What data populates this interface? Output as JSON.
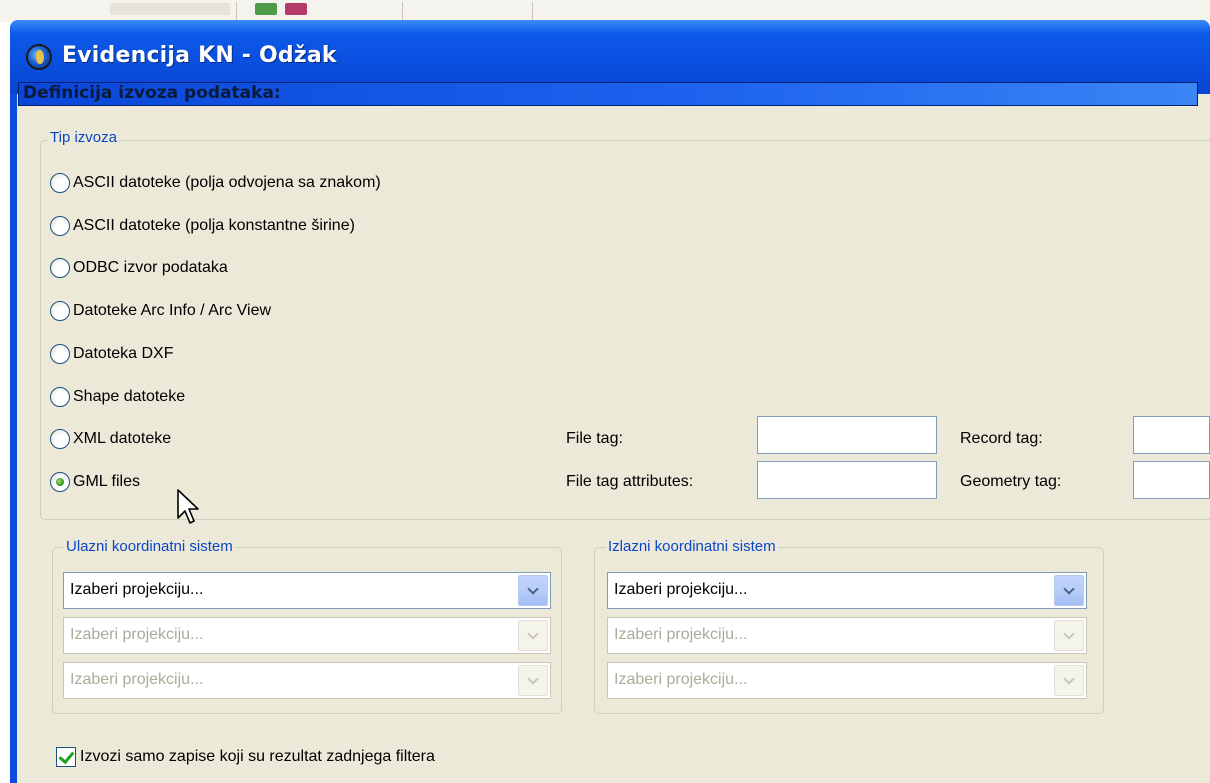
{
  "window": {
    "title": "Evidencija KN - Odžak"
  },
  "section_title": "Definicija izvoza podataka:",
  "export_type": {
    "legend": "Tip izvoza",
    "options": [
      {
        "label": "ASCII datoteke (polja odvojena sa znakom)",
        "checked": false
      },
      {
        "label": "ASCII datoteke (polja konstantne širine)",
        "checked": false
      },
      {
        "label": "ODBC izvor podataka",
        "checked": false
      },
      {
        "label": "Datoteke Arc Info / Arc View",
        "checked": false
      },
      {
        "label": "Datoteka DXF",
        "checked": false
      },
      {
        "label": "Shape datoteke",
        "checked": false
      },
      {
        "label": "XML datoteke",
        "checked": false
      },
      {
        "label": "GML files",
        "checked": true
      }
    ],
    "fields": {
      "file_tag_label": "File tag:",
      "file_tag_value": "",
      "record_tag_label": "Record tag:",
      "record_tag_value": "",
      "file_tag_attributes_label": "File tag attributes:",
      "file_tag_attributes_value": "",
      "geometry_tag_label": "Geometry tag:",
      "geometry_tag_value": ""
    }
  },
  "input_crs": {
    "legend": "Ulazni koordinatni sistem",
    "combos": [
      {
        "value": "Izaberi projekciju...",
        "enabled": true
      },
      {
        "value": "Izaberi projekciju...",
        "enabled": false
      },
      {
        "value": "Izaberi projekciju...",
        "enabled": false
      }
    ]
  },
  "output_crs": {
    "legend": "Izlazni koordinatni sistem",
    "combos": [
      {
        "value": "Izaberi projekciju...",
        "enabled": true
      },
      {
        "value": "Izaberi projekciju...",
        "enabled": false
      },
      {
        "value": "Izaberi projekciju...",
        "enabled": false
      }
    ]
  },
  "filter_checkbox": {
    "label": "Izvozi samo zapise koji su rezultat zadnjega filtera",
    "checked": true
  },
  "icons": {
    "app": "globe-icon",
    "cursor": "mouse-pointer-icon",
    "dropdown": "chevron-down-icon"
  },
  "colors": {
    "title_bar": "#0a4fe0",
    "client_bg": "#ece9d8",
    "legend_text": "#0b46c8",
    "section_header": "#1e64ef"
  }
}
